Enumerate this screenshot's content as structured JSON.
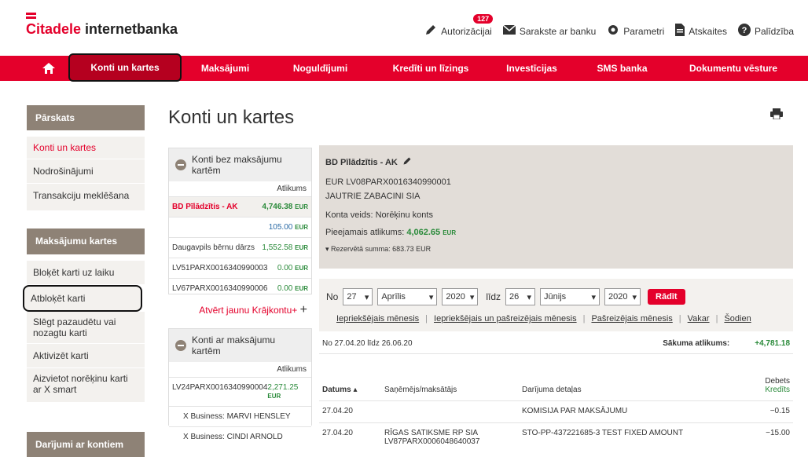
{
  "brand": {
    "name_red": "Citadele",
    "name_rest": " internetbanka"
  },
  "top_links": {
    "authorizations": "Autorizācijai",
    "auth_badge": "127",
    "messages": "Sarakste ar banku",
    "settings": "Parametri",
    "reports": "Atskaites",
    "help": "Palīdzība"
  },
  "nav": {
    "active": "Konti un kartes",
    "items": [
      "Maksājumi",
      "Noguldījumi",
      "Kredīti un līzings",
      "Investīcijas",
      "SMS banka",
      "Dokumentu vēsture"
    ]
  },
  "sidebar": {
    "overview": {
      "title": "Pārskats",
      "items": [
        "Konti un kartes",
        "Nodrošinājumi",
        "Transakciju meklēšana"
      ]
    },
    "cards": {
      "title": "Maksājumu kartes",
      "items": [
        "Bloķēt karti uz laiku",
        "Atbloķēt karti",
        "Slēgt pazaudētu vai nozagtu karti",
        "Aktivizēt karti",
        "Aizvietot norēķinu karti ar X smart"
      ]
    },
    "accounts": {
      "title": "Darījumi ar kontiem"
    }
  },
  "page_title": "Konti un kartes",
  "panel1": {
    "title": "Konti bez maksājumu kartēm",
    "col": "Atlikums",
    "rows": [
      {
        "name": "BD Pīlādzītis - AK",
        "amount": "4,746.38",
        "cur": "EUR"
      },
      {
        "name": "",
        "amount": "105.00",
        "cur": "EUR"
      },
      {
        "name": "Daugavpils bērnu dārzs",
        "amount": "1,552.58",
        "cur": "EUR"
      },
      {
        "name": "LV51PARX0016340990003",
        "amount": "0.00",
        "cur": "EUR"
      },
      {
        "name": "LV67PARX0016340990006",
        "amount": "0.00",
        "cur": "EUR"
      }
    ],
    "new_link": "Atvērt jaunu Krājkontu+"
  },
  "panel2": {
    "title": "Konti ar maksājumu kartēm",
    "col": "Atlikums",
    "rows": [
      {
        "name": "LV24PARX0016340990004",
        "amount": "2,271.25",
        "cur": "EUR"
      },
      {
        "name": "X Business: MARVI HENSLEY",
        "amount": "",
        "cur": ""
      },
      {
        "name": "X Business: CINDI ARNOLD",
        "amount": "",
        "cur": ""
      }
    ]
  },
  "details": {
    "title": "BD Pīlādzītis - AK",
    "iban": "EUR LV08PARX0016340990001",
    "owner": "JAUTRIE ZABACINI SIA",
    "type": "Konta veids: Norēķinu konts",
    "avail_label": "Pieejamais atlikums:",
    "avail_amount": "4,062.65",
    "avail_cur": "EUR",
    "reserved": "Rezervētā summa: 683.73 EUR"
  },
  "filter": {
    "from_label": "No",
    "from_day": "27",
    "from_month": "Aprīlis",
    "from_year": "2020",
    "to_label": "līdz",
    "to_day": "26",
    "to_month": "Jūnijs",
    "to_year": "2020",
    "show": "Rādīt",
    "quick": [
      "Iepriekšējais mēnesis",
      "Iepriekšējais un pašreizējais mēnesis",
      "Pašreizējais mēnesis",
      "Vakar",
      "Šodien"
    ]
  },
  "transactions": {
    "period": "No 27.04.20 līdz 26.06.20",
    "start_label": "Sākuma atlikums:",
    "start_amount": "+4,781.18",
    "cols": {
      "date": "Datums",
      "party": "Saņēmējs/maksātājs",
      "details": "Darījuma detaļas",
      "debit": "Debets",
      "credit": "Kredīts"
    },
    "rows": [
      {
        "date": "27.04.20",
        "party": "",
        "party2": "",
        "details": "KOMISIJA PAR MAKSĀJUMU",
        "amount": "−0.15"
      },
      {
        "date": "27.04.20",
        "party": "RĪGAS SATIKSME RP SIA",
        "party2": "LV87PARX0006048640037",
        "details": "STO-PP-437221685-3 TEST FIXED AMOUNT",
        "amount": "−15.00"
      }
    ]
  },
  "colors": {
    "accent": "#e4002b",
    "sidebar_head": "#8e8276",
    "positive": "#2a8a3a"
  }
}
